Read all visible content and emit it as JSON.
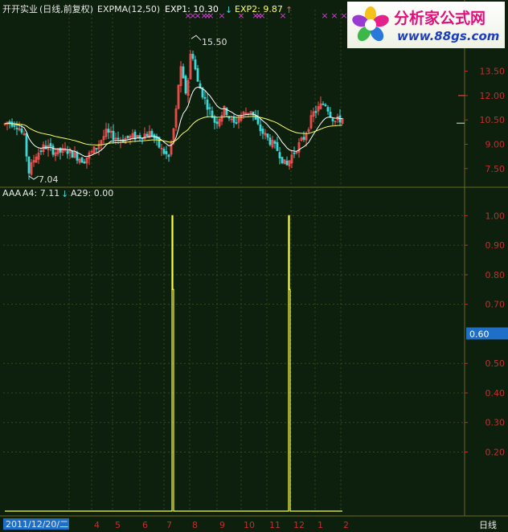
{
  "header": {
    "stock": "开开实业",
    "period": "(日线,前复权)",
    "indicator": "EXPMA(12,50)",
    "exp1": "EXP1: 10.30",
    "exp2": "EXP2: 9.87",
    "high_marker": "15.50",
    "low_marker": "7.04"
  },
  "lower_header": {
    "name": "AAA",
    "a4": "A4: 7.11",
    "a29": "A29: 0.00"
  },
  "footer": {
    "date": "2011/12/20/二",
    "period": "日线"
  },
  "logo": {
    "name": "分析家公式网",
    "url": "www.88gs.com"
  },
  "colors": {
    "background": "#0d1f0d",
    "up": "#ff5050",
    "down": "#3cd8d8",
    "exp1": "#ffffff",
    "exp2": "#ffff60",
    "signal": "#ffff40",
    "grid": "#6a6a20",
    "axis_text": "#c03030",
    "marker": "#d040d0"
  },
  "icons": {
    "exp1_arrow": "arrow-down-icon",
    "exp2_arrow": "arrow-up-icon",
    "a4_arrow": "arrow-down-icon"
  },
  "chart_data": [
    {
      "type": "candlestick",
      "title": "开开实业(日线,前复权) EXPMA(12,50)",
      "ylim": [
        6.5,
        16.5
      ],
      "y_ticks": [
        "13.50",
        "12.00",
        "10.50",
        "9.00",
        "7.50"
      ],
      "series": [
        {
          "name": "EXP1",
          "last": 10.3
        },
        {
          "name": "EXP2",
          "last": 9.87
        }
      ],
      "high": 15.5,
      "low": 7.04
    },
    {
      "type": "line",
      "title": "AAA",
      "ylim": [
        0,
        1.05
      ],
      "y_ticks": [
        "1.00",
        "0.90",
        "0.80",
        "0.70",
        "0.50",
        "0.40",
        "0.30",
        "0.20"
      ],
      "current_value": "0.60",
      "series": [
        {
          "name": "AAA signal",
          "values": [
            0,
            0,
            0,
            0,
            0,
            0,
            0,
            0,
            0,
            1.0,
            0.75,
            0,
            0,
            0,
            0,
            0,
            0,
            0,
            0,
            0,
            1.0,
            0.75,
            0,
            0,
            0,
            0
          ]
        }
      ]
    }
  ],
  "x_axis": {
    "month_labels": [
      "4",
      "5",
      "6",
      "7",
      "8",
      "9",
      "10",
      "11",
      "12",
      "1",
      "2"
    ]
  }
}
